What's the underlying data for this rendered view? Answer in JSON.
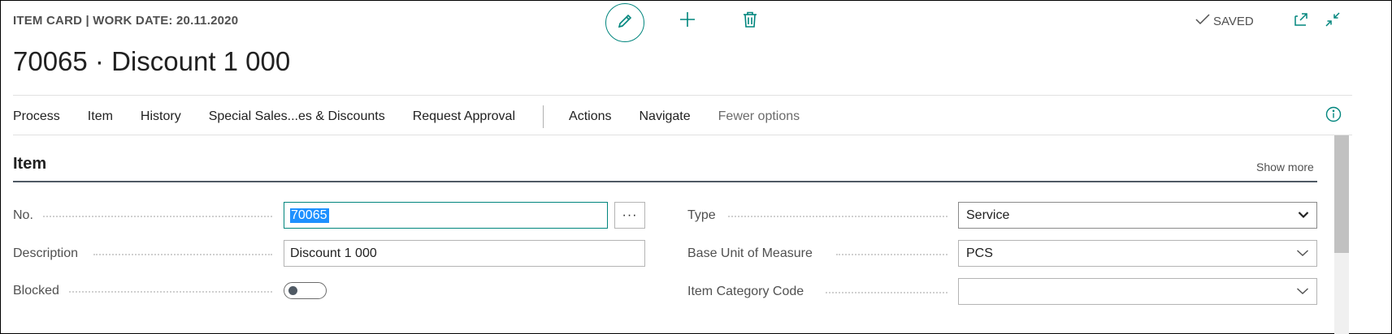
{
  "header": {
    "breadcrumb": "ITEM CARD | WORK DATE: 20.11.2020",
    "title": "70065 · Discount 1 000",
    "saved_label": "SAVED"
  },
  "icons": {
    "edit": "pencil-icon",
    "new": "plus-icon",
    "delete": "trash-icon",
    "saved": "checkmark-icon",
    "popout": "open-in-new-window-icon",
    "collapse": "collapse-icon",
    "info": "info-icon",
    "chevron": "chevron-down-icon"
  },
  "actions": {
    "primary": [
      "Process",
      "Item",
      "History",
      "Special Sales...es & Discounts",
      "Request Approval"
    ],
    "secondary": [
      "Actions",
      "Navigate"
    ],
    "fewer_options": "Fewer options"
  },
  "fasttab": {
    "title": "Item",
    "show_more": "Show more"
  },
  "fields": {
    "no": {
      "label": "No.",
      "value": "70065",
      "lookup_label": "···"
    },
    "description": {
      "label": "Description",
      "value": "Discount 1 000"
    },
    "blocked": {
      "label": "Blocked",
      "value": false
    },
    "type": {
      "label": "Type",
      "value": "Service"
    },
    "base_unit": {
      "label": "Base Unit of Measure",
      "value": "PCS"
    },
    "item_category": {
      "label": "Item Category Code",
      "value": ""
    }
  },
  "colors": {
    "accent": "#00857d",
    "selection": "#1e90ff",
    "text": "#212121",
    "muted": "#505050"
  }
}
